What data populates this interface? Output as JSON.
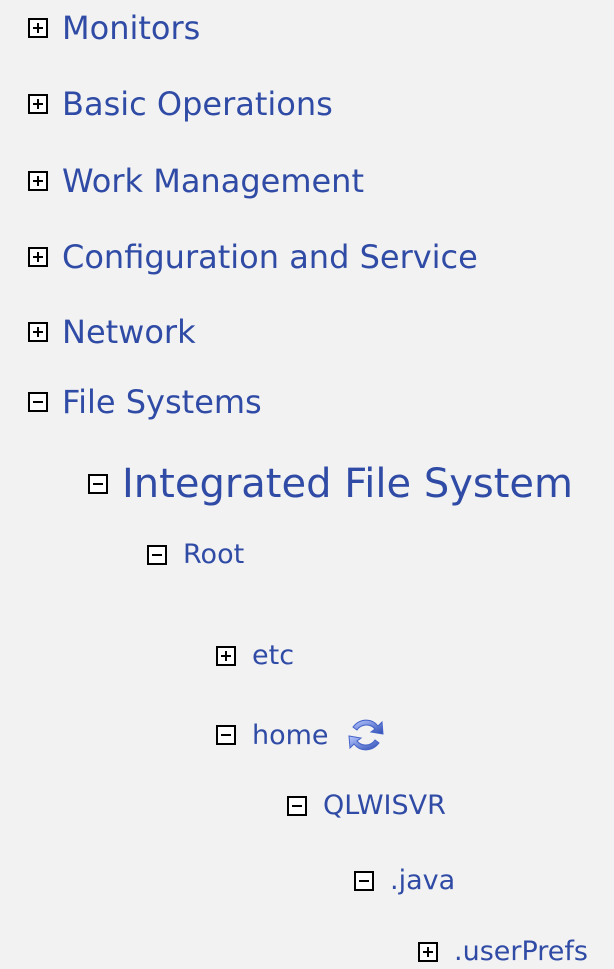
{
  "tree": {
    "items": [
      {
        "label": "Monitors"
      },
      {
        "label": "Basic Operations"
      },
      {
        "label": "Work Management"
      },
      {
        "label": "Configuration and Service"
      },
      {
        "label": "Network"
      },
      {
        "label": "File Systems"
      }
    ],
    "integrated_file_system": "Integrated File System",
    "root": "Root",
    "etc": "etc",
    "home": "home",
    "qlwisvr": "QLWISVR",
    "java": ".java",
    "userprefs": ".userPrefs"
  },
  "icons": {
    "expand": "plus-box-icon",
    "collapse": "minus-box-icon",
    "refresh": "refresh-icon"
  }
}
